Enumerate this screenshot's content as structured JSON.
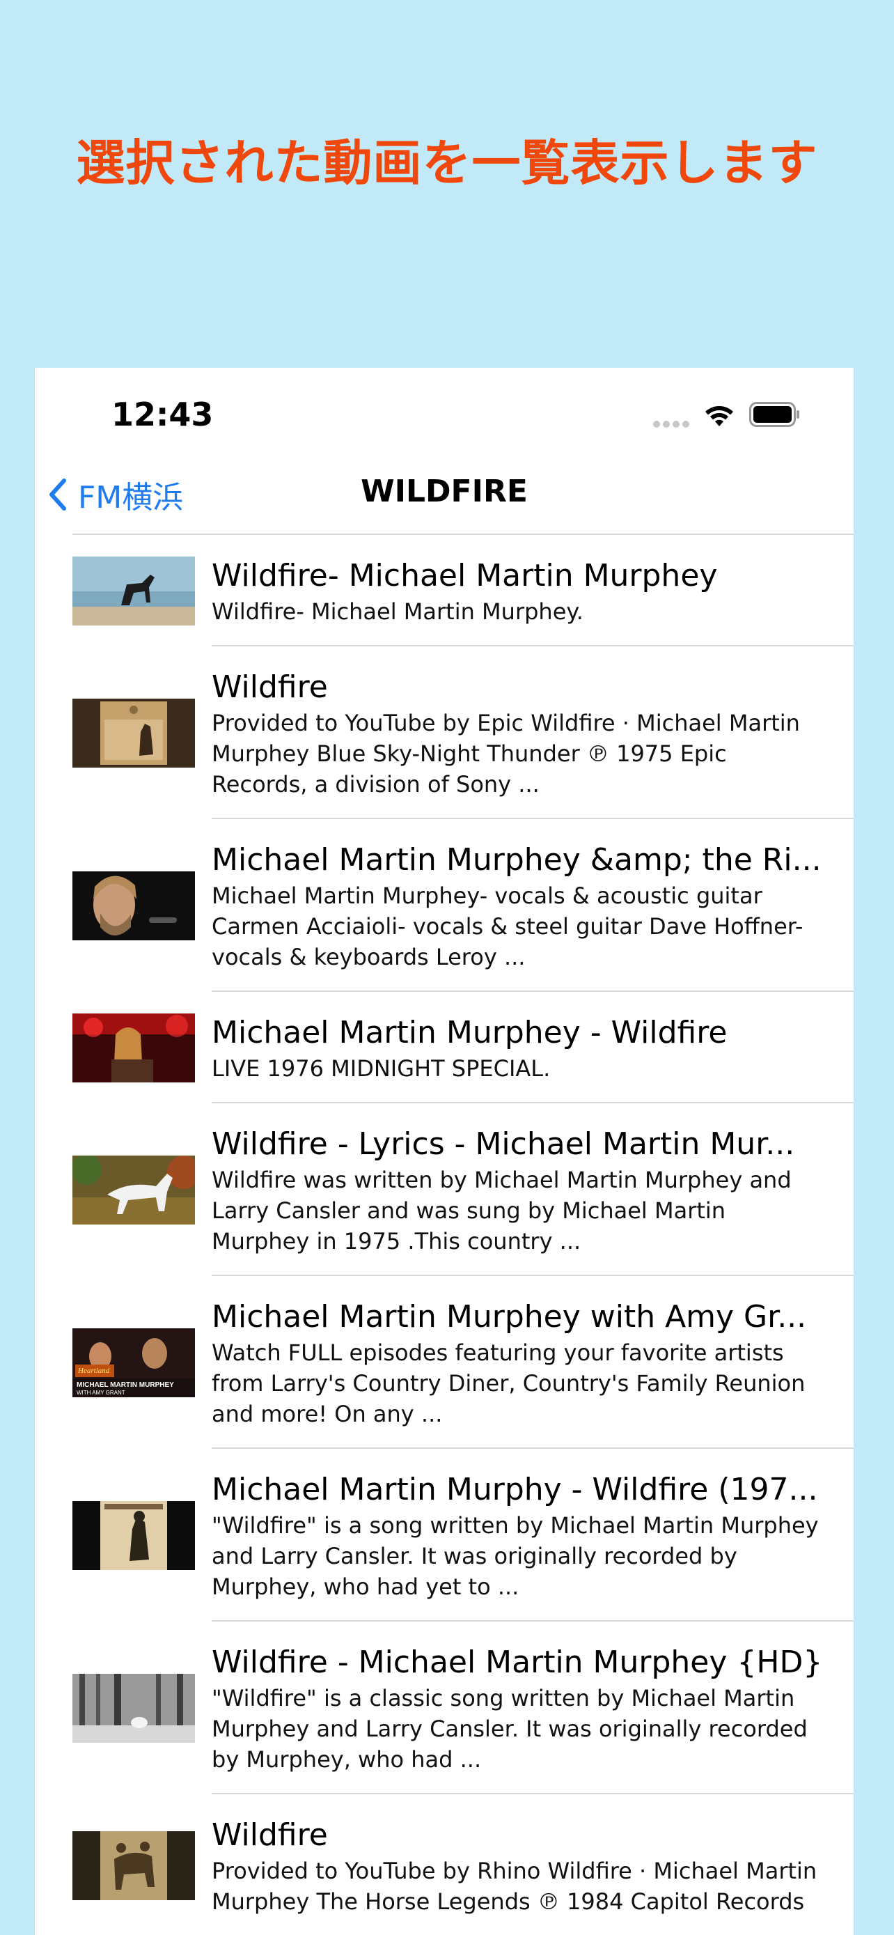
{
  "banner": {
    "text": "選択された動画を一覧表示します",
    "color": "#f0480c"
  },
  "status_bar": {
    "time": "12:43"
  },
  "nav": {
    "back_label": "FM横浜",
    "title": "WILDFIRE",
    "accent": "#1f7cf0"
  },
  "videos": [
    {
      "title": "Wildfire- Michael Martin Murphey",
      "desc": "Wildfire- Michael Martin Murphey."
    },
    {
      "title": "Wildfire",
      "desc": "Provided to YouTube by Epic Wildfire · Michael Martin Murphey Blue Sky-Night Thunder ℗ 1975 Epic Records, a division of Sony ..."
    },
    {
      "title": "Michael Martin Murphey &amp; the Ri...",
      "desc": "Michael Martin Murphey- vocals & acoustic guitar Carmen Acciaioli- vocals & steel guitar Dave Hoffner- vocals & keyboards Leroy ..."
    },
    {
      "title": "Michael Martin Murphey - Wildfire",
      "desc": "LIVE 1976 MIDNIGHT SPECIAL."
    },
    {
      "title": "Wildfire - Lyrics - Michael Martin Mur...",
      "desc": "Wildfire was written by Michael Martin Murphey and Larry Cansler and was sung by Michael Martin Murphey in 1975 .This country ..."
    },
    {
      "title": "Michael Martin Murphey with Amy  Gr...",
      "desc": "Watch FULL episodes featuring your favorite artists from Larry's Country Diner, Country's Family Reunion and more! On any ...",
      "thumb_text": [
        "Heartland",
        "MICHAEL MARTIN MURPHEY",
        "WITH AMY GRANT"
      ]
    },
    {
      "title": "Michael Martin Murphy - Wildfire (197...",
      "desc": "\"Wildfire\" is a song written by Michael Martin Murphey and Larry Cansler. It was originally recorded by Murphey, who had yet to ..."
    },
    {
      "title": "Wildfire - Michael Martin Murphey {HD}",
      "desc": "\"Wildfire\" is a classic song written by Michael Martin Murphey and Larry Cansler. It was originally recorded by Murphey, who had ..."
    },
    {
      "title": "Wildfire",
      "desc": "Provided to YouTube by Rhino Wildfire · Michael Martin Murphey The Horse Legends ℗ 1984 Capitol Records"
    }
  ]
}
